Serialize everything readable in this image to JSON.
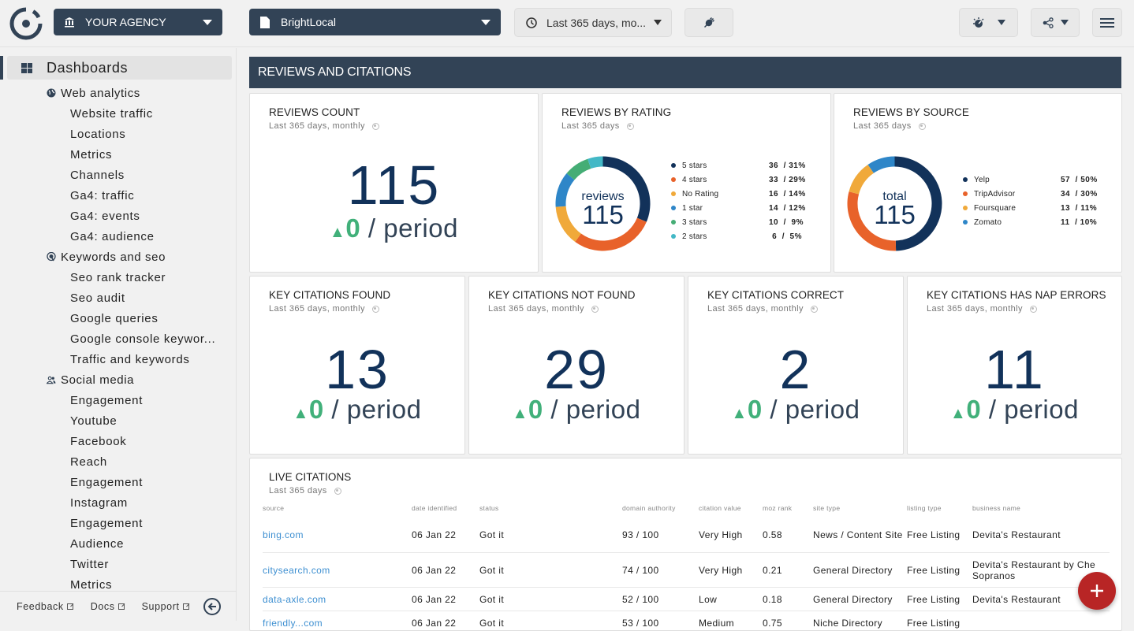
{
  "topbar": {
    "agency_label": "YOUR AGENCY",
    "report_label": "BrightLocal",
    "date_range_label": "Last 365 days, mo...",
    "icons": {
      "agency": "bank-icon",
      "report": "document-icon",
      "date": "clock-icon",
      "integration": "plug-icon",
      "theme": "theme-icon",
      "share": "share-icon",
      "menu": "hamburger-icon"
    }
  },
  "sidebar": {
    "dashboards_label": "Dashboards",
    "groups": [
      {
        "label": "Web analytics",
        "icon": "globe-icon",
        "items": [
          "Website traffic",
          "Locations",
          "Metrics",
          "Channels",
          "Ga4: traffic",
          "Ga4: events",
          "Ga4: audience"
        ]
      },
      {
        "label": "Keywords and seo",
        "icon": "target-icon",
        "items": [
          "Seo rank tracker",
          "Seo audit",
          "Google queries",
          "Google console keywor...",
          "Traffic and keywords"
        ]
      },
      {
        "label": "Social media",
        "icon": "people-icon",
        "items": [
          "Engagement",
          "Youtube",
          "Facebook",
          "Reach",
          "Engagement",
          "Instagram",
          "Engagement",
          "Audience",
          "Twitter",
          "Metrics"
        ]
      }
    ],
    "footer": {
      "feedback": "Feedback",
      "docs": "Docs",
      "support": "Support"
    }
  },
  "section": {
    "title": "REVIEWS AND CITATIONS"
  },
  "cards": {
    "reviews_count": {
      "title": "REVIEWS COUNT",
      "subtitle": "Last 365 days, monthly",
      "value": "115",
      "delta": "0",
      "delta_suffix": "/ period",
      "trend": "up"
    },
    "reviews_by_rating": {
      "title": "REVIEWS BY RATING",
      "subtitle": "Last 365 days",
      "center_label": "reviews",
      "center_value": "115"
    },
    "reviews_by_source": {
      "title": "REVIEWS BY SOURCE",
      "subtitle": "Last 365 days",
      "center_label": "total",
      "center_value": "115"
    },
    "kpis": [
      {
        "title": "KEY CITATIONS FOUND",
        "subtitle": "Last 365 days, monthly",
        "value": "13",
        "delta": "0",
        "delta_suffix": "/ period"
      },
      {
        "title": "KEY CITATIONS NOT FOUND",
        "subtitle": "Last 365 days, monthly",
        "value": "29",
        "delta": "0",
        "delta_suffix": "/ period"
      },
      {
        "title": "KEY CITATIONS CORRECT",
        "subtitle": "Last 365 days, monthly",
        "value": "2",
        "delta": "0",
        "delta_suffix": "/ period"
      },
      {
        "title": "KEY CITATIONS HAS NAP ERRORS",
        "subtitle": "Last 365 days, monthly",
        "value": "11",
        "delta": "0",
        "delta_suffix": "/ period"
      }
    ],
    "live_citations": {
      "title": "LIVE CITATIONS",
      "subtitle": "Last 365 days",
      "columns": [
        "source",
        "date identified",
        "status",
        "domain authority",
        "citation value",
        "moz rank",
        "site type",
        "listing type",
        "business name"
      ],
      "rows": [
        [
          "bing.com",
          "06 Jan 22",
          "Got it",
          "93 / 100",
          "Very High",
          "0.58",
          "News / Content Site",
          "Free Listing",
          "Devita's Restaurant"
        ],
        [
          "citysearch.com",
          "06 Jan 22",
          "Got it",
          "74 / 100",
          "Very High",
          "0.21",
          "General Directory",
          "Free Listing",
          "Devita's Restaurant by Che Sopranos"
        ],
        [
          "data-axle.com",
          "06 Jan 22",
          "Got it",
          "52 / 100",
          "Low",
          "0.18",
          "General Directory",
          "Free Listing",
          "Devita's Restaurant"
        ],
        [
          "friendly...com",
          "06 Jan 22",
          "Got it",
          "53 / 100",
          "Medium",
          "0.75",
          "Niche Directory",
          "Free Listing",
          ""
        ]
      ]
    }
  },
  "colors": {
    "navy": "#12325a",
    "orange": "#e8622a",
    "yellow": "#f0a93a",
    "blue": "#2e86c8",
    "green": "#45ad75",
    "teal": "#43b8c6",
    "header": "#324356",
    "positive": "#41b07a",
    "fab": "#b82525",
    "link": "#3d8fd1"
  },
  "chart_data": [
    {
      "type": "pie",
      "title": "REVIEWS BY RATING",
      "center_text": "reviews 115",
      "categories": [
        "5 stars",
        "4 stars",
        "No Rating",
        "1 star",
        "3 stars",
        "2 stars"
      ],
      "values": [
        36,
        33,
        16,
        14,
        10,
        6
      ],
      "percent": [
        31,
        29,
        14,
        12,
        9,
        5
      ],
      "colors": [
        "#12325a",
        "#e8622a",
        "#f0a93a",
        "#2e86c8",
        "#45ad75",
        "#43b8c6"
      ],
      "legend": "right"
    },
    {
      "type": "pie",
      "title": "REVIEWS BY SOURCE",
      "center_text": "total 115",
      "categories": [
        "Yelp",
        "TripAdvisor",
        "Foursquare",
        "Zomato"
      ],
      "values": [
        57,
        34,
        13,
        11
      ],
      "percent": [
        50,
        30,
        11,
        10
      ],
      "colors": [
        "#12325a",
        "#e8622a",
        "#f0a93a",
        "#2e86c8"
      ],
      "legend": "right"
    }
  ]
}
